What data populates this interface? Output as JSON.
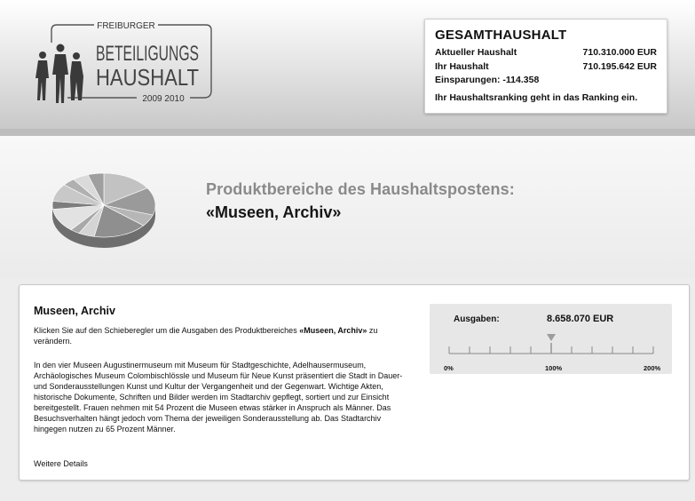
{
  "logo": {
    "line_top": "FREIBURGER",
    "line_middle": "BETEILIGUNGS",
    "line_bottom": "HAUSHALT",
    "years": "2009 2010"
  },
  "summary": {
    "title": "GESAMTHAUSHALT",
    "current_label": "Aktueller Haushalt",
    "current_value": "710.310.000 EUR",
    "yours_label": "Ihr Haushalt",
    "yours_value": "710.195.642 EUR",
    "savings_text": "Einsparungen: -114.358",
    "ranking_text": "Ihr Haushaltsranking geht in das Ranking ein."
  },
  "section": {
    "heading_line1": "Produktbereiche des Haushaltspostens:",
    "heading_line2": "«Museen, Archiv»"
  },
  "content": {
    "title": "Museen, Archiv",
    "intro_before": "Klicken Sie auf den Schieberegler um die Ausgaben des Produktbereiches ",
    "intro_bold": "«Museen, Archiv»",
    "intro_after": " zu verändern.",
    "body": "In den vier Museen Augustinermuseum mit Museum für Stadtgeschichte, Adelhausermuseum, Archäologisches Museum Colombischlössle und Museum für Neue Kunst präsentiert die Stadt in Dauer- und Sonderausstellungen Kunst und Kultur der Vergangenheit und der Gegenwart. Wichtige Akten, historische Dokumente, Schriften und Bilder werden im Stadtarchiv gepflegt, sortiert und zur Einsicht bereitgestellt. Frauen nehmen mit 54 Prozent die Museen etwas stärker in Anspruch als Männer. Das Besuchsverhalten hängt jedoch vom Thema der jeweiligen Sonderausstellung ab. Das Stadtarchiv hingegen nutzen zu 65 Prozent Männer.",
    "details_link": "Weitere Details"
  },
  "slider": {
    "label": "Ausgaben:",
    "value_text": "8.658.070 EUR",
    "tick_min": "0%",
    "tick_mid": "100%",
    "tick_max": "200%",
    "level_percent": 100
  },
  "pie": {
    "slice_colors": [
      "#c2c2c2",
      "#9a9a9a",
      "#b6b6b6",
      "#8f8f8f",
      "#d4d4d4",
      "#a8a8a8",
      "#e2e2e2",
      "#7d7d7d",
      "#c8c8c8",
      "#b0b0b0",
      "#dadada",
      "#9f9f9f"
    ]
  }
}
